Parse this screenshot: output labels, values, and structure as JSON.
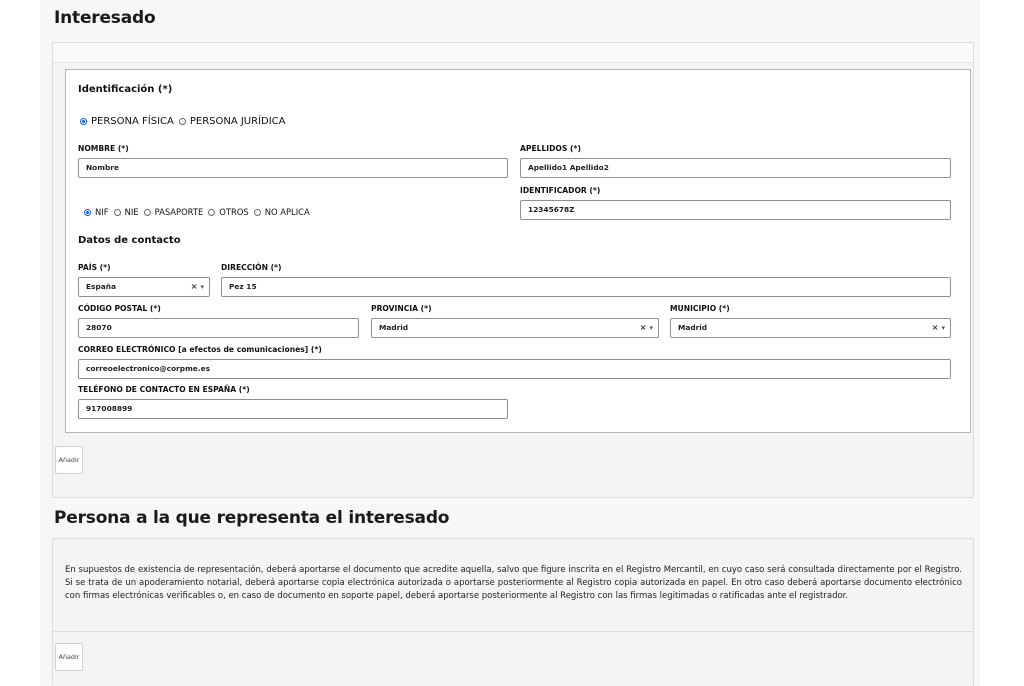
{
  "interesado": {
    "title": "Interesado",
    "identificacion_heading": "Identificación (*)",
    "persona_tipo": {
      "options": [
        "PERSONA FÍSICA",
        "PERSONA JURÍDICA"
      ],
      "selected": "PERSONA FÍSICA"
    },
    "nombre": {
      "label": "NOMBRE (*)",
      "value": "Nombre"
    },
    "apellidos": {
      "label": "APELLIDOS (*)",
      "value": "Apellido1 Apellido2"
    },
    "doc_tipo": {
      "options": [
        "NIF",
        "NIE",
        "PASAPORTE",
        "OTROS",
        "NO APLICA"
      ],
      "selected": "NIF"
    },
    "identificador": {
      "label": "IDENTIFICADOR (*)",
      "value": "12345678Z"
    },
    "contacto_heading": "Datos de contacto",
    "pais": {
      "label": "PAÍS (*)",
      "value": "España"
    },
    "direccion": {
      "label": "DIRECCIÓN (*)",
      "value": "Pez 15"
    },
    "codigo_postal": {
      "label": "CÓDIGO POSTAL (*)",
      "value": "28070"
    },
    "provincia": {
      "label": "PROVINCIA (*)",
      "value": "Madrid"
    },
    "municipio": {
      "label": "MUNICIPIO (*)",
      "value": "Madrid"
    },
    "correo": {
      "label": "CORREO ELECTRÓNICO [a efectos de comunicaciones] (*)",
      "value": "correoelectronico@corpme.es"
    },
    "telefono": {
      "label": "TELÉFONO DE CONTACTO EN ESPAÑA (*)",
      "value": "917008899"
    },
    "add_label": "Añadir"
  },
  "representado": {
    "title": "Persona a la que representa el interesado",
    "info": "En supuestos de existencia de representación, deberá aportarse el documento que acredite aquella, salvo que figure inscrita en el Registro Mercantil, en cuyo caso será consultada directamente por el Registro. Si se trata de un apoderamiento notarial, deberá aportarse copia electrónica autorizada o aportarse posteriormente al Registro copia autorizada en papel. En otro caso deberá aportarse documento electrónico con firmas electrónicas verificables o, en caso de documento en soporte papel, deberá aportarse posteriormente al Registro con las firmas legitimadas o ratificadas ante el registrador.",
    "add_label": "Añadir"
  },
  "select_controls": {
    "clear": "×",
    "arrow": "▾"
  }
}
